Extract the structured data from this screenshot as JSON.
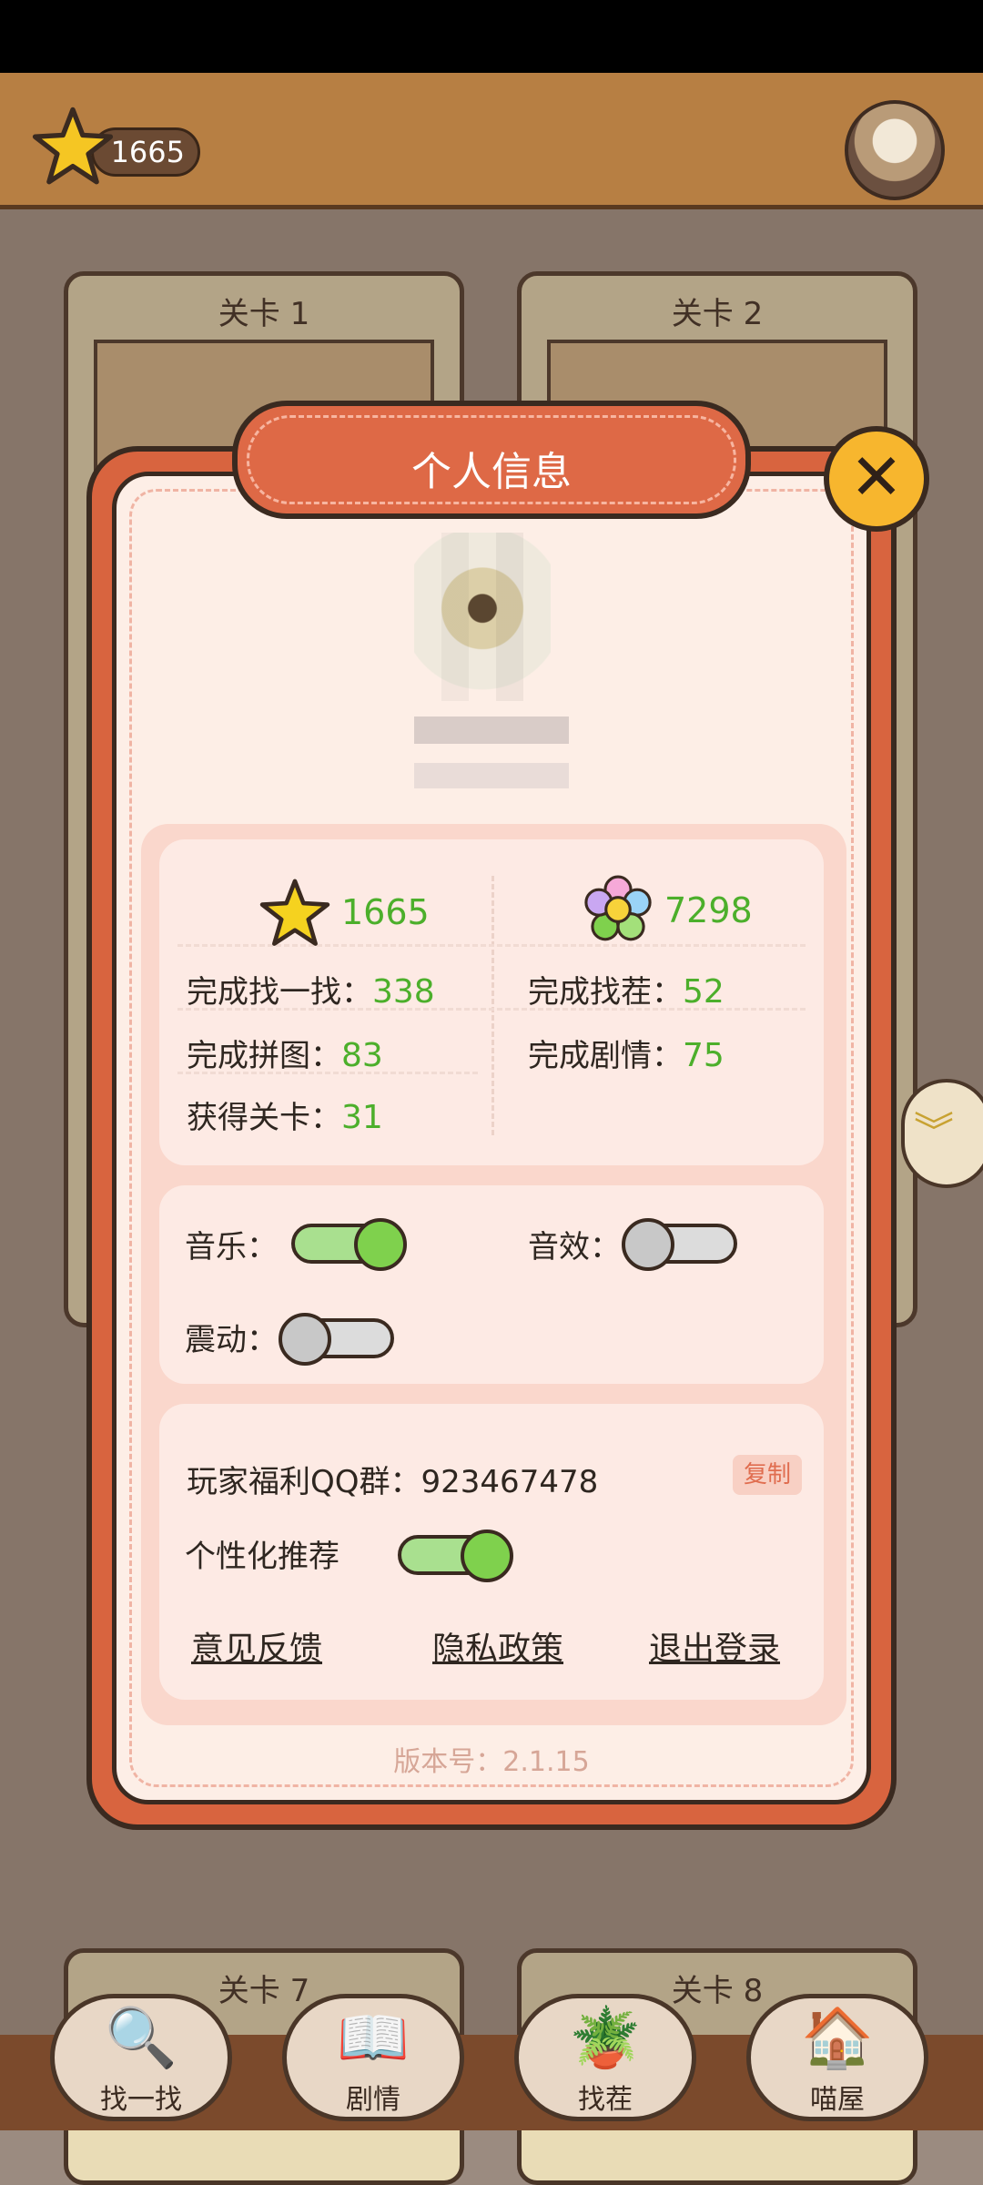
{
  "top_bar": {
    "coins": "1665"
  },
  "background_levels": [
    {
      "title": "关卡 1"
    },
    {
      "title": "关卡 2"
    },
    {
      "title": "关卡 7"
    },
    {
      "title": "关卡 8"
    }
  ],
  "bottom_nav": [
    {
      "label": "找一找",
      "icon": "magnifier-icon"
    },
    {
      "label": "剧情",
      "icon": "book-icon"
    },
    {
      "label": "找茬",
      "icon": "plants-icon"
    },
    {
      "label": "喵屋",
      "icon": "house-icon"
    }
  ],
  "modal": {
    "title": "个人信息",
    "stats": {
      "stars": "1665",
      "flowers": "7298",
      "find_label": "完成找一找：",
      "find_value": "338",
      "diff_label": "完成找茬：",
      "diff_value": "52",
      "puzzle_label": "完成拼图：",
      "puzzle_value": "83",
      "story_label": "完成剧情：",
      "story_value": "75",
      "levels_label": "获得关卡：",
      "levels_value": "31"
    },
    "settings": {
      "music_label": "音乐：",
      "music_on": true,
      "sfx_label": "音效：",
      "sfx_on": false,
      "vibration_label": "震动：",
      "vibration_on": false
    },
    "misc": {
      "qq_label": "玩家福利QQ群：",
      "qq_number": "923467478",
      "copy_label": "复制",
      "personalize_label": "个性化推荐",
      "personalize_on": true,
      "feedback_label": "意见反馈",
      "privacy_label": "隐私政策",
      "logout_label": "退出登录"
    },
    "version": "版本号：2.1.15"
  },
  "colors": {
    "modal_frame": "#d8643f",
    "modal_bg": "#fdeee6",
    "accent_green": "#4caf2b",
    "close_button": "#f7b62e"
  }
}
